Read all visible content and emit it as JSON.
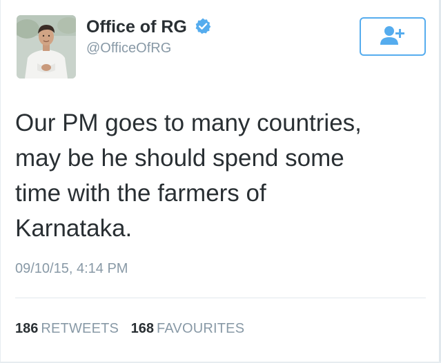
{
  "tweet": {
    "author": {
      "display_name": "Office of RG",
      "handle": "@OfficeOfRG",
      "verified": true,
      "avatar_icon": "profile-photo"
    },
    "follow_button_icon": "follow-user-plus-icon",
    "text": "Our PM goes to many countries,\nmay be he should spend some\ntime with the farmers of\nKarnataka.",
    "timestamp": "09/10/15, 4:14 PM",
    "stats": {
      "retweets_count": "186",
      "retweets_label": "RETWEETS",
      "favourites_count": "168",
      "favourites_label": "FAVOURITES"
    }
  },
  "colors": {
    "accent": "#55acee",
    "text": "#292f33",
    "muted": "#8899a6",
    "divider": "#e1e8ed"
  }
}
